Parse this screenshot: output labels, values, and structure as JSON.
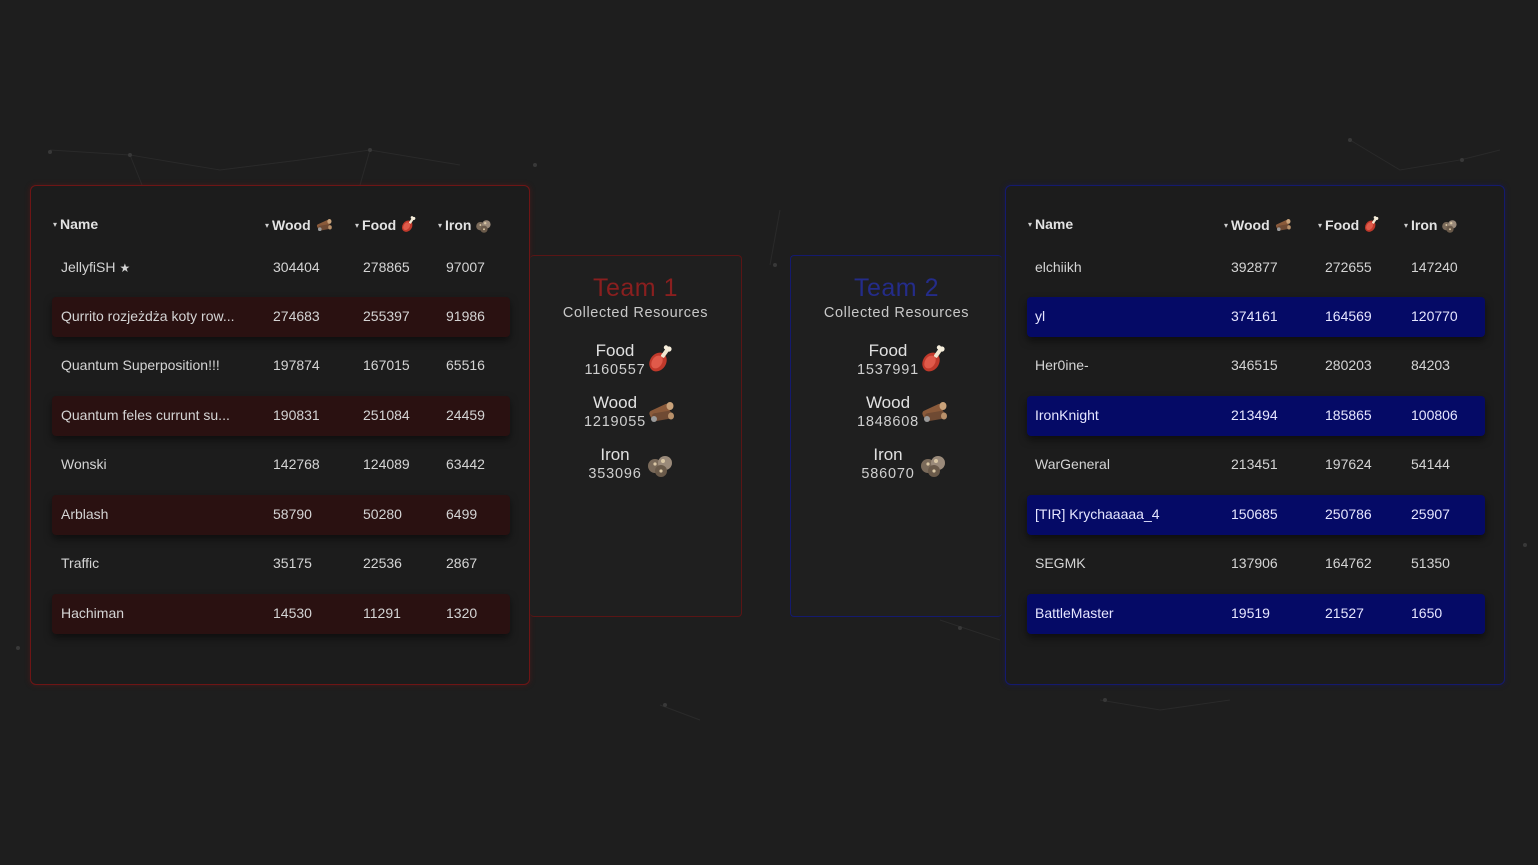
{
  "headers": {
    "name": "Name",
    "wood": "Wood",
    "food": "Food",
    "iron": "Iron",
    "sort_glyph": "▾"
  },
  "team1_table": {
    "accent": "#6e1515",
    "rows": [
      {
        "name": "JellyfiSH",
        "badge": "★",
        "wood": "304404",
        "food": "278865",
        "iron": "97007"
      },
      {
        "name": "Qurrito rozjeżdża koty row...",
        "wood": "274683",
        "food": "255397",
        "iron": "91986"
      },
      {
        "name": "Quantum Superposition!!!",
        "wood": "197874",
        "food": "167015",
        "iron": "65516"
      },
      {
        "name": "Quantum feles currunt su...",
        "wood": "190831",
        "food": "251084",
        "iron": "24459"
      },
      {
        "name": "Wonski",
        "wood": "142768",
        "food": "124089",
        "iron": "63442"
      },
      {
        "name": "Arblash",
        "wood": "58790",
        "food": "50280",
        "iron": "6499"
      },
      {
        "name": "Traffic",
        "wood": "35175",
        "food": "22536",
        "iron": "2867"
      },
      {
        "name": "Hachiman",
        "wood": "14530",
        "food": "11291",
        "iron": "1320"
      }
    ]
  },
  "team2_table": {
    "accent": "#141a6e",
    "rows": [
      {
        "name": "elchiikh",
        "wood": "392877",
        "food": "272655",
        "iron": "147240"
      },
      {
        "name": "yl",
        "wood": "374161",
        "food": "164569",
        "iron": "120770"
      },
      {
        "name": "Her0ine-",
        "wood": "346515",
        "food": "280203",
        "iron": "84203"
      },
      {
        "name": "IronKnight",
        "wood": "213494",
        "food": "185865",
        "iron": "100806"
      },
      {
        "name": "WarGeneral",
        "wood": "213451",
        "food": "197624",
        "iron": "54144"
      },
      {
        "name": "[TIR] Krychaaaaa_4",
        "wood": "150685",
        "food": "250786",
        "iron": "25907"
      },
      {
        "name": "SEGMK",
        "wood": "137906",
        "food": "164762",
        "iron": "51350"
      },
      {
        "name": "BattleMaster",
        "wood": "19519",
        "food": "21527",
        "iron": "1650"
      }
    ]
  },
  "team1_summary": {
    "title": "Team 1",
    "subtitle": "Collected Resources",
    "color": "#8a1f1f",
    "resources": [
      {
        "label": "Food",
        "value": "1160557",
        "icon": "meat-icon"
      },
      {
        "label": "Wood",
        "value": "1219055",
        "icon": "wood-icon"
      },
      {
        "label": "Iron",
        "value": "353096",
        "icon": "iron-ore-icon"
      }
    ]
  },
  "team2_summary": {
    "title": "Team 2",
    "subtitle": "Collected Resources",
    "color": "#242c8a",
    "resources": [
      {
        "label": "Food",
        "value": "1537991",
        "icon": "meat-icon"
      },
      {
        "label": "Wood",
        "value": "1848608",
        "icon": "wood-icon"
      },
      {
        "label": "Iron",
        "value": "586070",
        "icon": "iron-ore-icon"
      }
    ]
  }
}
